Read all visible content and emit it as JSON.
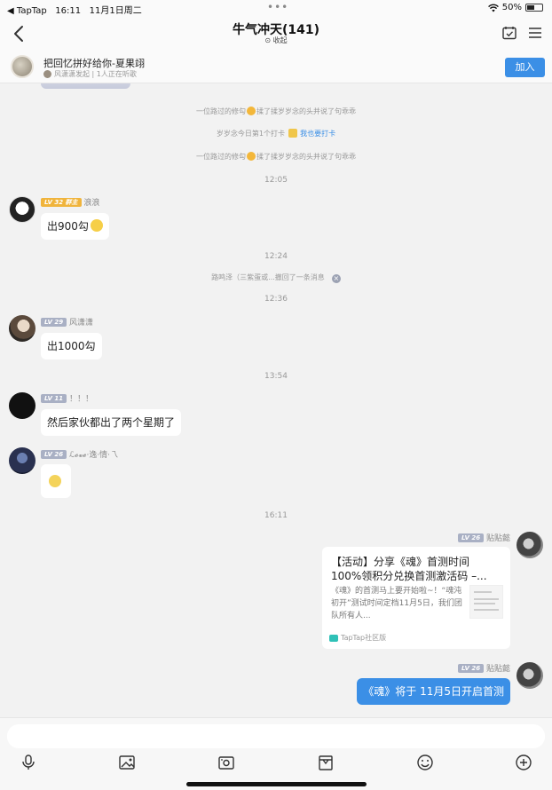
{
  "status_bar": {
    "back_app": "◀ TapTap",
    "time": "16:11",
    "date": "11月1日周二",
    "battery": "50%",
    "battery_level": 0.5
  },
  "header": {
    "title": "牛气冲天(141)",
    "collapse_label": "收起"
  },
  "group": {
    "name": "把回忆拼好给你-夏果翊",
    "meta": "风潇潇发起 | 1人正在听歌",
    "join_label": "加入"
  },
  "system_messages": [
    {
      "text_before": "一位路过的修勾",
      "text_after": "揉了揉岁岁念的头并说了句乖乖"
    },
    {
      "text_before": "岁岁念今日第1个打卡",
      "link": "我也要打卡"
    },
    {
      "text_before": "一位路过的修勾",
      "text_after": "揉了揉岁岁念的头并说了句乖乖"
    }
  ],
  "timestamps": [
    "12:05",
    "12:24",
    "12:36",
    "13:54",
    "16:11"
  ],
  "recall_notice": "路鸣泽（三紫蛋或...撤回了一条消息",
  "messages": [
    {
      "level": "LV 32",
      "badge": "群主",
      "name": "浪浪",
      "text": "出900勾"
    },
    {
      "level": "LV 29",
      "name": "风潇潇",
      "text": "出1000勾"
    },
    {
      "level": "LV 11",
      "name": "！！！",
      "text": "然后家伙都出了两个星期了"
    },
    {
      "level": "LV 26",
      "name": "ℒ𝓸𝓿𝓮·逸·情·乁"
    },
    {
      "level": "LV 26",
      "name": "贴贴懿"
    },
    {
      "level": "LV 26",
      "name": "贴贴懿",
      "text": "《魂》将于 11月5日开启首测"
    }
  ],
  "card": {
    "title": "【活动】分享《魂》首测时间100%领积分兑换首测激活码 –...",
    "desc": "《魂》的首测马上要开始啦~！“魂沌初开”测试时间定档11月5日，我们团队所有人...",
    "source": "TapTap社区版"
  },
  "icons": {
    "back": "chevron-left-icon",
    "calendar": "calendar-check-icon",
    "menu": "menu-icon",
    "mic": "microphone-icon",
    "image": "image-icon",
    "photo": "photo-icon",
    "gift": "gift-box-icon",
    "emoji": "emoji-icon",
    "add": "add-icon"
  },
  "colors": {
    "accent": "#3b8fe6",
    "background": "#f2f2f2",
    "owner_badge": "#f0b43c"
  }
}
